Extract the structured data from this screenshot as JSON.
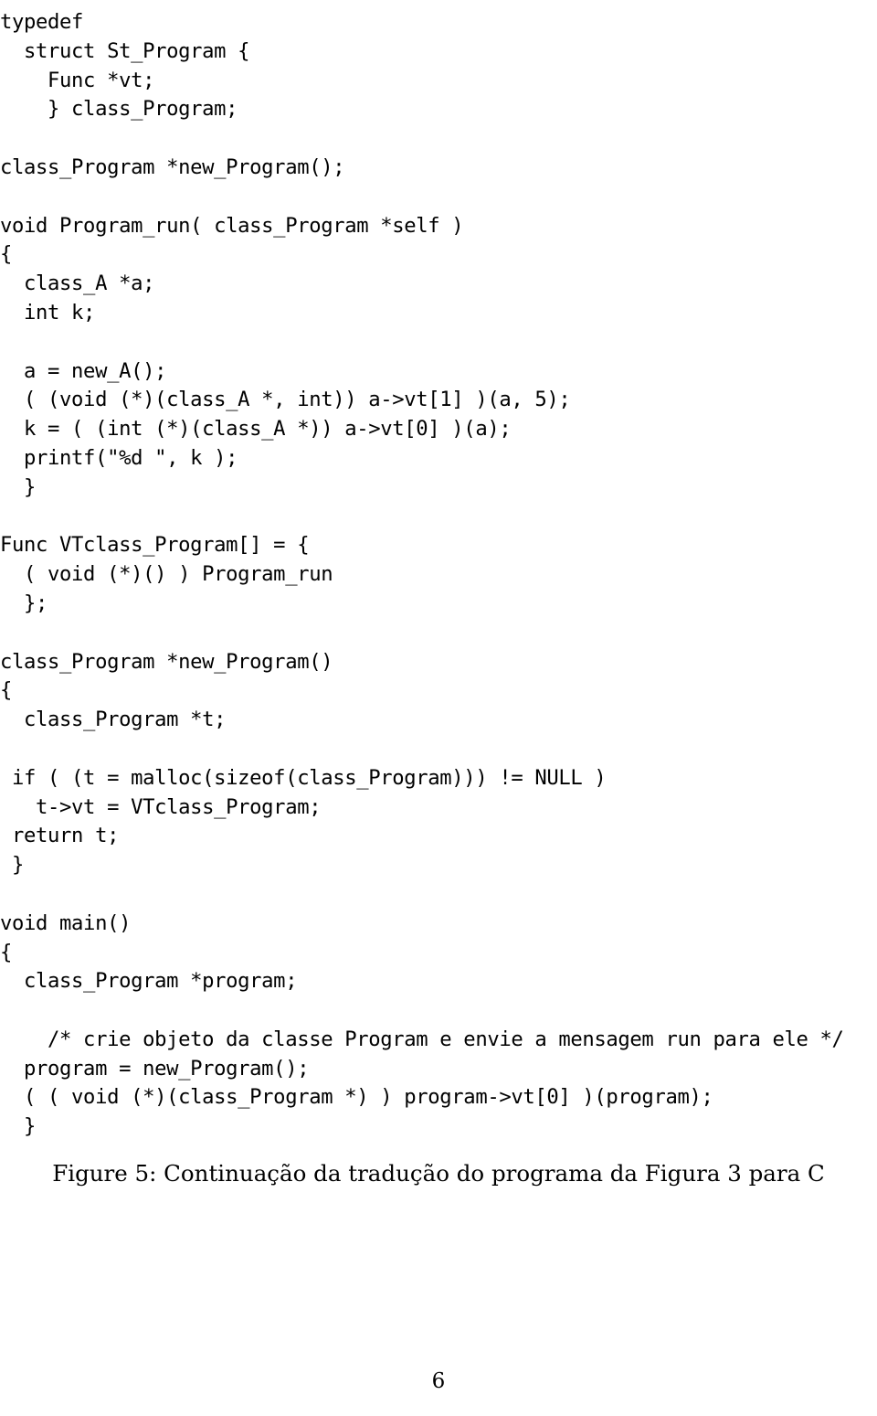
{
  "document": {
    "page_number": "6",
    "code_listing": {
      "language": "C",
      "lines": [
        "typedef",
        "  struct St_Program {",
        "    Func *vt;",
        "    } class_Program;",
        "",
        "class_Program *new_Program();",
        "",
        "void Program_run( class_Program *self )",
        "{",
        "  class_A *a;",
        "  int k;",
        "",
        "  a = new_A();",
        "  ( (void (*)(class_A *, int)) a->vt[1] )(a, 5);",
        "  k = ( (int (*)(class_A *)) a->vt[0] )(a);",
        "  printf(\"%d \", k );",
        "  }",
        "",
        "Func VTclass_Program[] = {",
        "  ( void (*)() ) Program_run",
        "  };",
        "",
        "class_Program *new_Program()",
        "{",
        "  class_Program *t;",
        "",
        " if ( (t = malloc(sizeof(class_Program))) != NULL )",
        "   t->vt = VTclass_Program;",
        " return t;",
        " }",
        "",
        "void main()",
        "{",
        "  class_Program *program;",
        "",
        "    /* crie objeto da classe Program e envie a mensagem run para ele */",
        "  program = new_Program();",
        "  ( ( void (*)(class_Program *) ) program->vt[0] )(program);",
        "  }"
      ]
    },
    "figure_caption": "Figure 5: Continuação da tradução do programa da Figura 3 para C"
  }
}
